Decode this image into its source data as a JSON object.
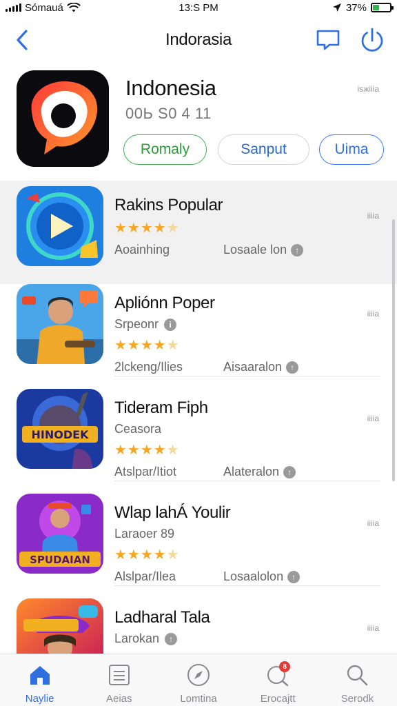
{
  "status_bar": {
    "carrier": "Sómauá",
    "time": "13:S PM",
    "battery": "37%",
    "battery_level": 0.37
  },
  "nav": {
    "title": "Indorasia",
    "back_icon": "chevron-left-icon",
    "chat_icon": "chat-bubble-icon",
    "power_icon": "power-icon"
  },
  "hero": {
    "title": "Indonesia",
    "subtitle": "00Ь S0 4 11",
    "meta": "іѕжіііа",
    "buttons": [
      {
        "label": "Romaly",
        "style": "green"
      },
      {
        "label": "Sanput",
        "style": "gray"
      },
      {
        "label": "Uima",
        "style": "blue"
      }
    ]
  },
  "list": [
    {
      "title": "Rakins Popular",
      "subtitle": "",
      "rating": 4.5,
      "left_meta": "Aoainhing",
      "right_meta": "Losaale lon",
      "count": "ііііа",
      "selected": true
    },
    {
      "title": "Apliónn Poper",
      "subtitle": "Srpeonr",
      "rating": 4.5,
      "left_meta": "2lckeng/Ilies",
      "right_meta": "Aisaaralon",
      "count": "ііііа",
      "selected": false
    },
    {
      "title": "Tideram Fiph",
      "subtitle": "Ceasora",
      "rating": 4.5,
      "left_meta": "Atslpar/Itiot",
      "right_meta": "Alateralon",
      "count": "ііііа",
      "selected": false
    },
    {
      "title": "Wlap lahÁ Youlir",
      "subtitle": "Laraoer 89",
      "rating": 4.5,
      "left_meta": "Alslpar/Ilea",
      "right_meta": "Losaalolon",
      "count": "ііііа",
      "selected": false
    },
    {
      "title": "Ladharal Tala",
      "subtitle": "Larokan",
      "rating": 4.5,
      "left_meta": "",
      "right_meta": "",
      "count": "ііііа",
      "selected": false
    }
  ],
  "tabs": [
    {
      "label": "Naylie",
      "icon": "home-icon",
      "active": true
    },
    {
      "label": "Aeias",
      "icon": "list-icon",
      "active": false
    },
    {
      "label": "Lomtina",
      "icon": "compass-icon",
      "active": false
    },
    {
      "label": "Erocajtt",
      "icon": "updates-icon",
      "active": false,
      "badge": "8"
    },
    {
      "label": "Serodk",
      "icon": "search-icon",
      "active": false
    }
  ],
  "colors": {
    "accent": "#2f6fe0",
    "green": "#3fb04a",
    "star": "#f5a623"
  }
}
